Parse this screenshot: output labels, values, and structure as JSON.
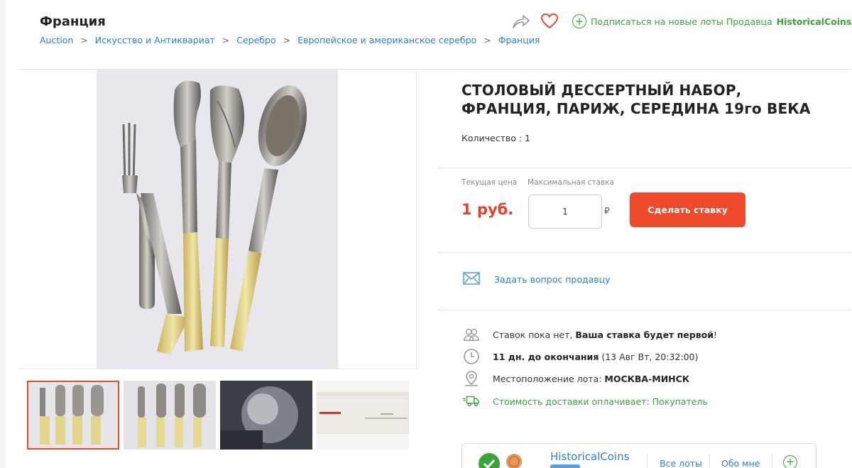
{
  "header": {
    "category_title": "Франция",
    "breadcrumb": [
      "Auction",
      "Искусство и Антиквариат",
      "Серебро",
      "Европейское и американское серебро",
      "Франция"
    ],
    "breadcrumb_sep": ">",
    "subscribe_text": "Подписаться на новые лоты Продавца",
    "subscribe_seller": "HistoricalCoins"
  },
  "lot": {
    "title": "СТОЛОВЫЙ ДЕССЕРТНЫЙ НАБОР, ФРАНЦИЯ, ПАРИЖ, СЕРЕДИНА 19го ВЕКА",
    "quantity": "Количество : 1",
    "current_price_label": "Текущая цена",
    "max_bid_label": "Максимальная ставка",
    "current_price": "1 руб.",
    "bid_value": "1",
    "currency_symbol": "₽",
    "bid_button": "Сделать ставку",
    "ask_seller": "Задать вопрос продавцу",
    "bids_text": "Ставок пока нет, ",
    "bids_bold": "Ваша ставка будет первой",
    "bids_end": "!",
    "time_bold": "11 дн. до окончания",
    "time_rest": " (13 Авг Вт, 20:32:00)",
    "location_label": "Местоположение лота: ",
    "location_value": "МОСКВА-МИНСК",
    "shipping": "Стоимость доставки оплачивает: Покупатель"
  },
  "seller": {
    "name": "HistoricalCoins",
    "all_lots": "Все лоты",
    "about": "Обо мне"
  },
  "colors": {
    "accent": "#ee4a2b",
    "link": "#2a7fd4",
    "green": "#3aa33a"
  },
  "icons": [
    "share-icon",
    "heart-icon",
    "plus-circle-icon",
    "envelope-icon",
    "users-icon",
    "clock-icon",
    "location-icon",
    "truck-icon",
    "check-icon",
    "medal-icon"
  ]
}
